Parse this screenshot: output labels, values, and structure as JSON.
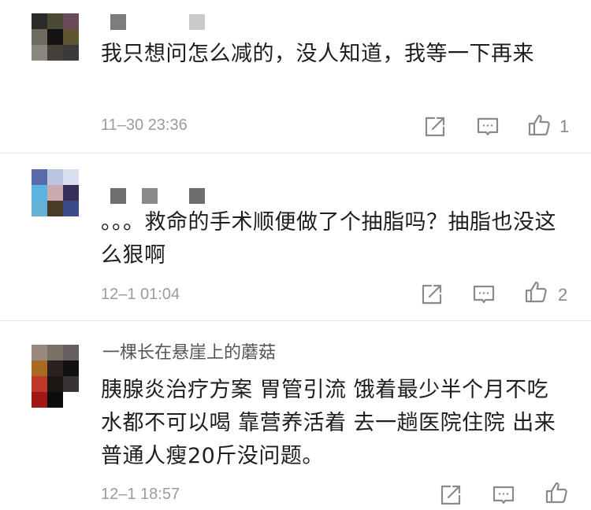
{
  "comments": [
    {
      "username": "",
      "content": "我只想问怎么减的，没人知道，我等一下再来",
      "time": "11–30 23:36",
      "likes": "1"
    },
    {
      "username": "",
      "content": "。。。救命的手术顺便做了个抽脂吗？抽脂也没这么狠啊",
      "time": "12–1 01:04",
      "likes": "2"
    },
    {
      "username": "一棵长在悬崖上的蘑菇",
      "content": "胰腺炎治疗方案 胃管引流 饿着最少半个月不吃 水都不可以喝 靠营养活着 去一趟医院住院 出来普通人瘦20斤没问题。",
      "time": "12–1 18:57",
      "likes": ""
    }
  ],
  "icons": {
    "share": "share-icon",
    "reply": "comment-icon",
    "like": "thumbs-up-icon"
  },
  "colors": {
    "text": "#1e1e1e",
    "meta": "#9b9b9b",
    "icon": "#8a8a8a",
    "divider": "#e6e6e6"
  }
}
